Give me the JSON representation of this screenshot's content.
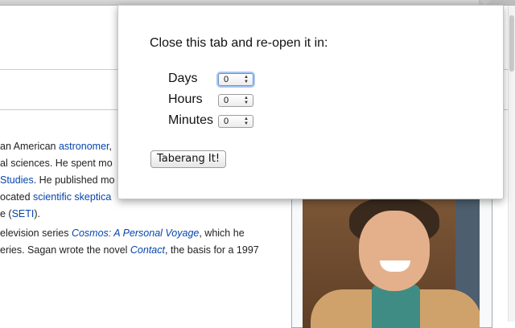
{
  "popup": {
    "title": "Close this tab and re-open it in:",
    "fields": [
      {
        "label": "Days",
        "value": "0"
      },
      {
        "label": "Hours",
        "value": "0"
      },
      {
        "label": "Minutes",
        "value": "0"
      }
    ],
    "button_label": "Taberang It!"
  },
  "article": {
    "line1_text": "an American ",
    "line1_link": "astronomer",
    "line1_tail": ",",
    "line2_text": "al sciences. He spent mo",
    "line3_link": "Studies",
    "line3_text": ". He published mo",
    "line4_text": "ocated ",
    "line4_link": "scientific skeptica",
    "line5_text": "e (",
    "line5_link": "SETI",
    "line5_tail": ").",
    "line6_text": "elevision series ",
    "line6_link": "Cosmos: A Personal Voyage",
    "line6_tail": ", which he",
    "line7_text": "eries. Sagan wrote the novel ",
    "line7_link": "Contact",
    "line7_tail": ", the basis for a 1997"
  },
  "colors": {
    "link": "#0645ad",
    "focus_ring": "#a9c6f2"
  },
  "icons": {
    "stepper_arrows": "up-down-arrows-icon"
  }
}
